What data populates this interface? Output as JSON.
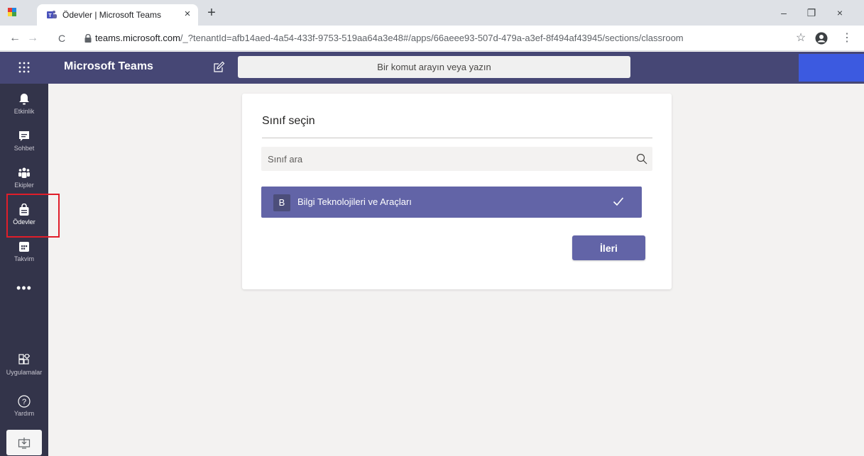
{
  "browser": {
    "tab_title": "Ödevler | Microsoft Teams",
    "close_tab": "×",
    "new_tab": "+",
    "url_host": "teams.microsoft.com",
    "url_rest": "/_?tenantId=afb14aed-4a54-433f-9753-519aa64a3e48#/apps/66aeee93-507d-479a-a3ef-8f494af43945/sections/classroom",
    "window_controls": {
      "minimize": "–",
      "restore": "❐",
      "close": "×"
    },
    "nav": {
      "back": "←",
      "forward": "→",
      "reload": "C"
    },
    "toolbar_icons": {
      "star": "☆",
      "menu": "⋮"
    }
  },
  "header": {
    "app_title": "Microsoft Teams",
    "command_placeholder": "Bir komut arayın veya yazın"
  },
  "rail": {
    "items": [
      {
        "label": "Etkinlik",
        "icon": "bell-icon"
      },
      {
        "label": "Sohbet",
        "icon": "chat-icon"
      },
      {
        "label": "Ekipler",
        "icon": "teams-icon"
      },
      {
        "label": "Ödevler",
        "icon": "assignments-icon",
        "active": true
      },
      {
        "label": "Takvim",
        "icon": "calendar-icon"
      }
    ],
    "more": "•••",
    "apps_label": "Uygulamalar",
    "help_label": "Yardım"
  },
  "card": {
    "title": "Sınıf seçin",
    "search_placeholder": "Sınıf ara",
    "selected_class": {
      "initial": "B",
      "name": "Bilgi Teknolojileri ve Araçları",
      "selected": true
    },
    "next_label": "İleri"
  },
  "colors": {
    "teams_purple": "#6264a7",
    "header_bg": "#464775",
    "rail_bg": "#33344a",
    "highlight_red": "#e01e2a"
  }
}
